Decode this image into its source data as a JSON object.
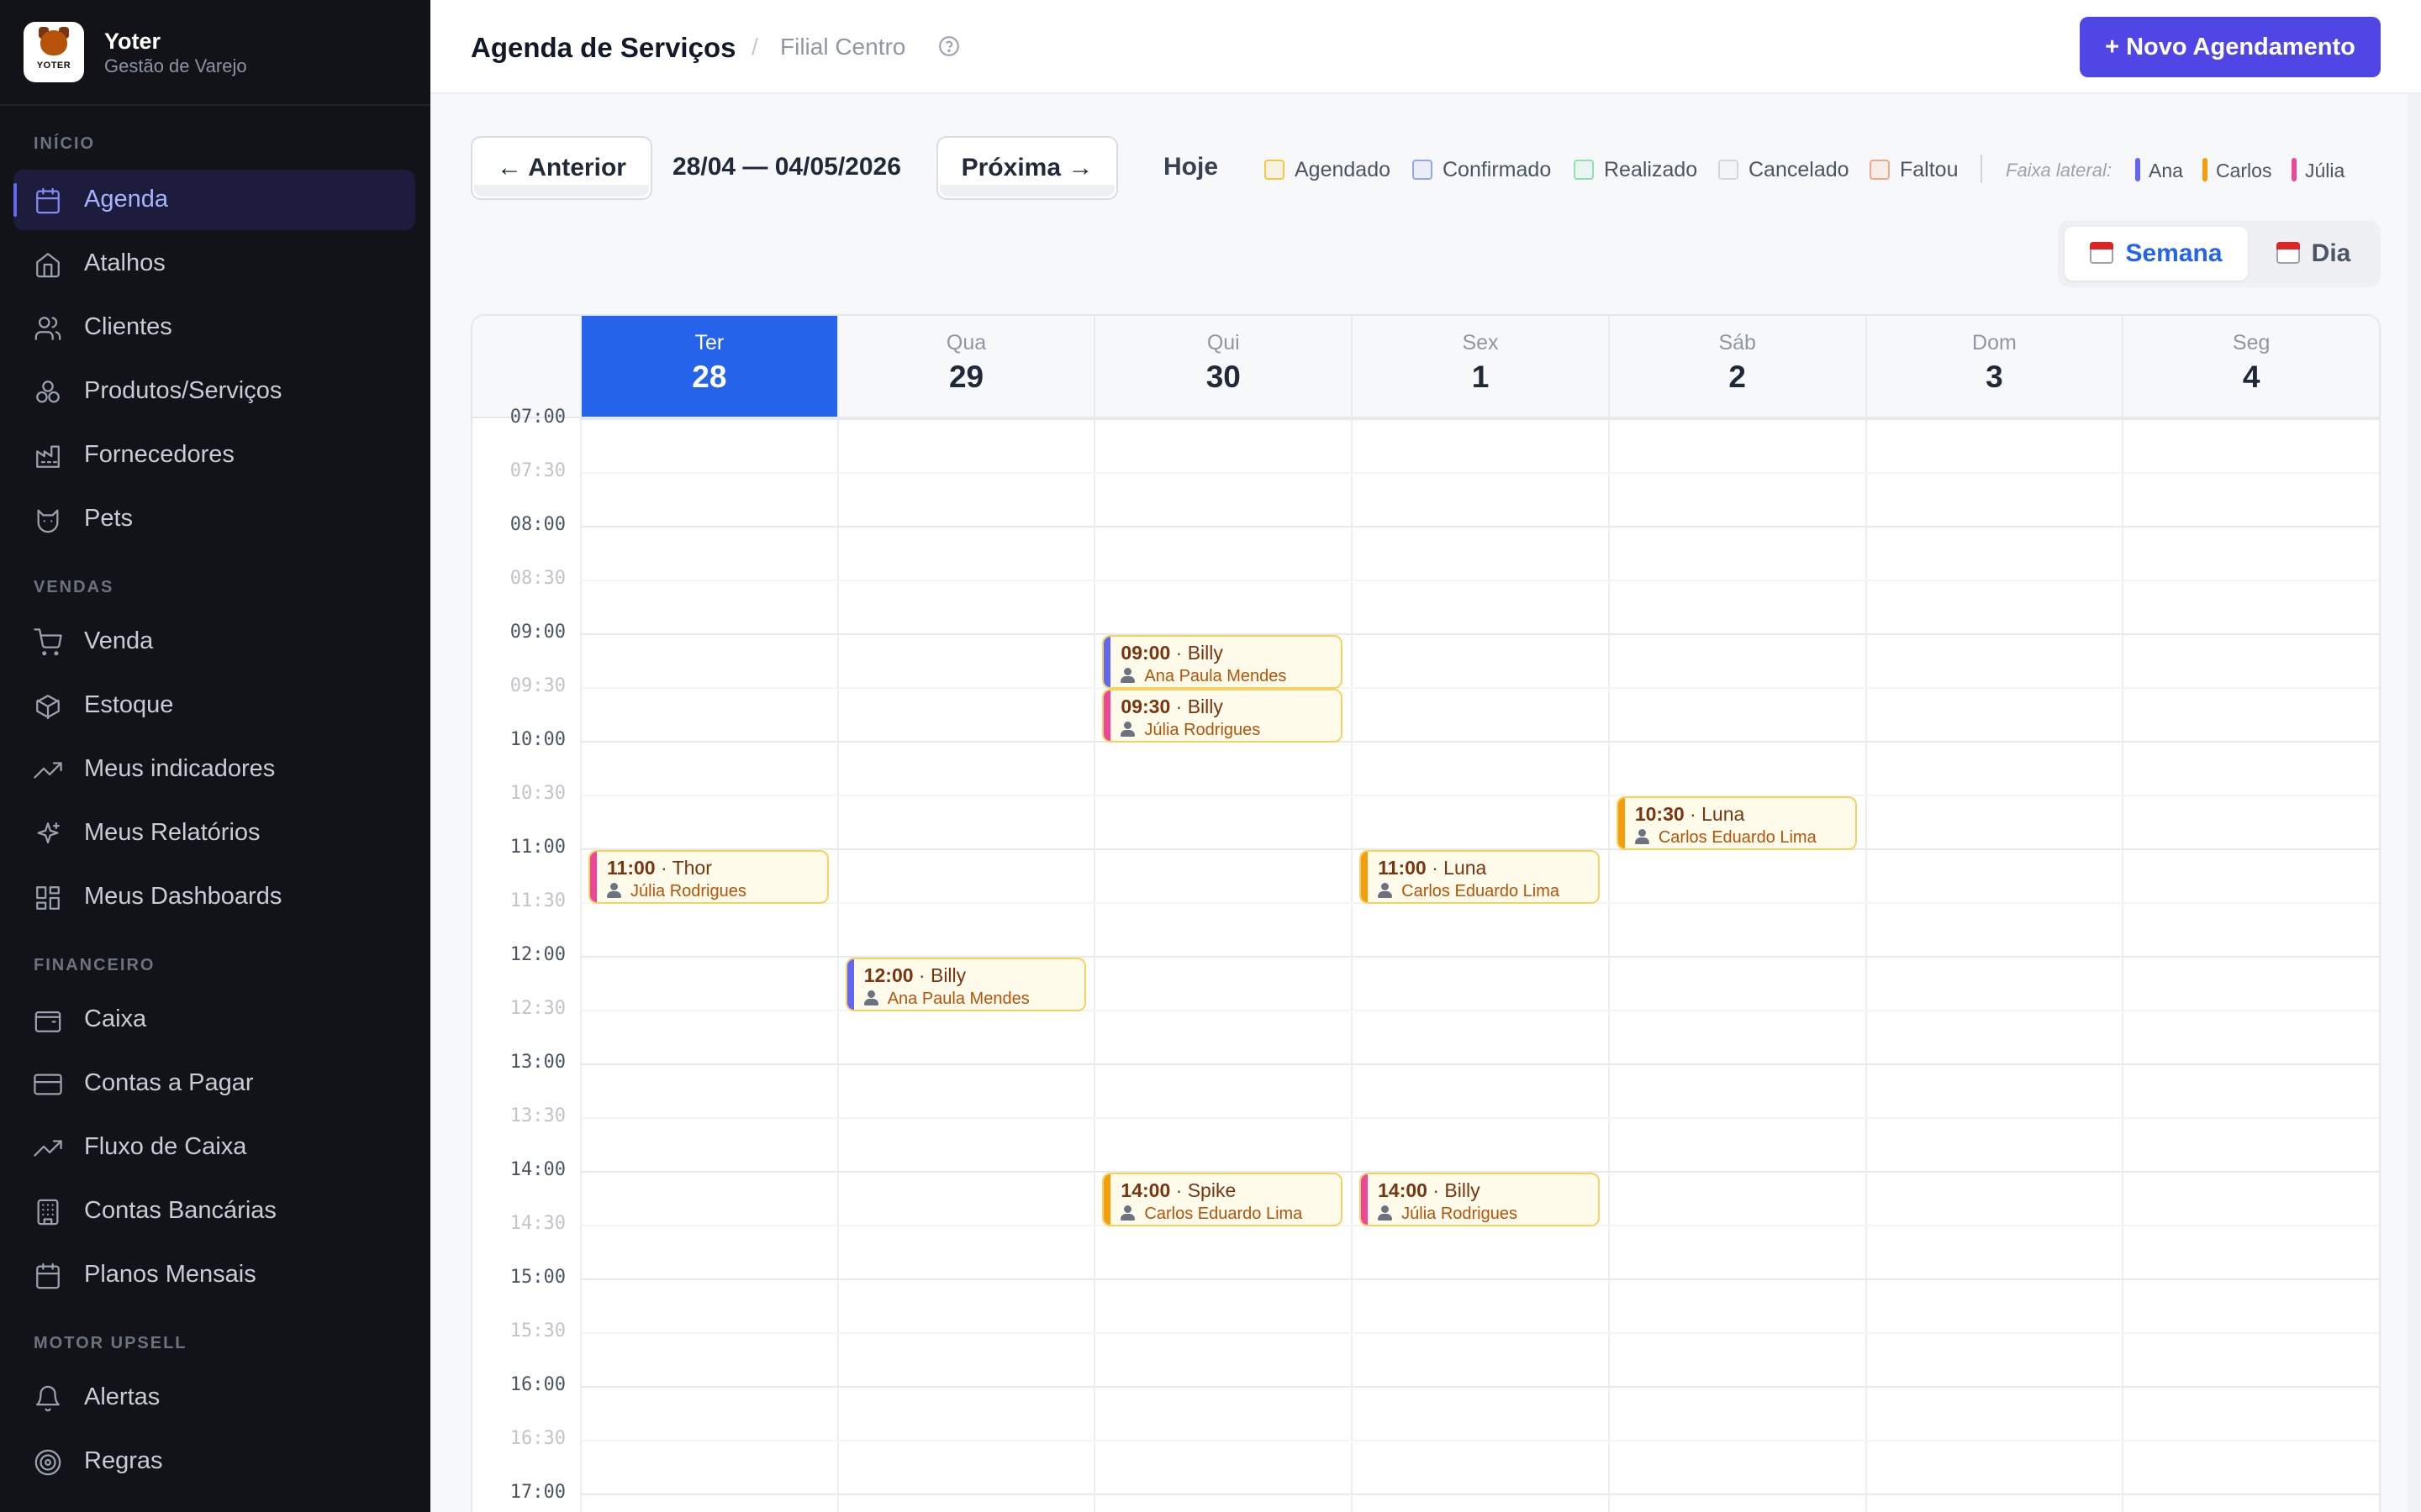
{
  "brand": {
    "name": "Yoter",
    "subtitle": "Gestão de Varejo",
    "logo_text": "YOTER",
    "logo_sub": "SISTEMA DE GESTÃO"
  },
  "sidebar": {
    "sections": [
      {
        "title": "INÍCIO",
        "items": [
          {
            "label": "Agenda",
            "icon": "calendar-icon",
            "active": true
          },
          {
            "label": "Atalhos",
            "icon": "home-icon"
          },
          {
            "label": "Clientes",
            "icon": "users-icon"
          },
          {
            "label": "Produtos/Serviços",
            "icon": "boxes-icon"
          },
          {
            "label": "Fornecedores",
            "icon": "factory-icon"
          },
          {
            "label": "Pets",
            "icon": "cat-icon"
          }
        ]
      },
      {
        "title": "VENDAS",
        "items": [
          {
            "label": "Venda",
            "icon": "cart-icon"
          },
          {
            "label": "Estoque",
            "icon": "package-icon"
          },
          {
            "label": "Meus indicadores",
            "icon": "trending-up-icon"
          },
          {
            "label": "Meus Relatórios",
            "icon": "sparkles-icon"
          },
          {
            "label": "Meus Dashboards",
            "icon": "dashboard-icon"
          }
        ]
      },
      {
        "title": "FINANCEIRO",
        "items": [
          {
            "label": "Caixa",
            "icon": "wallet-icon"
          },
          {
            "label": "Contas a Pagar",
            "icon": "credit-card-icon"
          },
          {
            "label": "Fluxo de Caixa",
            "icon": "trending-up-icon"
          },
          {
            "label": "Contas Bancárias",
            "icon": "building-icon"
          },
          {
            "label": "Planos Mensais",
            "icon": "calendar-icon"
          }
        ]
      },
      {
        "title": "MOTOR UPSELL",
        "items": [
          {
            "label": "Alertas",
            "icon": "bell-icon"
          },
          {
            "label": "Regras",
            "icon": "target-icon"
          }
        ]
      }
    ]
  },
  "header": {
    "title": "Agenda de Serviços",
    "separator": "/",
    "branch": "Filial Centro",
    "help_icon": "help-circle-icon",
    "new_button": "+ Novo Agendamento"
  },
  "toolbar": {
    "prev": "← Anterior",
    "range": "28/04 — 04/05/2026",
    "next": "Próxima →",
    "today": "Hoje",
    "legend": [
      {
        "label": "Agendado",
        "color": "#f5c842"
      },
      {
        "label": "Confirmado",
        "color": "#93a8e8"
      },
      {
        "label": "Realizado",
        "color": "#8ee0b4"
      },
      {
        "label": "Cancelado",
        "color": "#d4d6db"
      },
      {
        "label": "Faltou",
        "color": "#f0a58e"
      }
    ],
    "lane_label": "Faixa lateral:",
    "lanes": [
      {
        "label": "Ana",
        "color": "#6366f1"
      },
      {
        "label": "Carlos",
        "color": "#f59e0b"
      },
      {
        "label": "Júlia",
        "color": "#ec4899"
      }
    ],
    "views": {
      "week": "Semana",
      "day": "Dia",
      "active": "week"
    }
  },
  "calendar": {
    "days": [
      {
        "dow": "Ter",
        "num": "28",
        "today": true
      },
      {
        "dow": "Qua",
        "num": "29"
      },
      {
        "dow": "Qui",
        "num": "30"
      },
      {
        "dow": "Sex",
        "num": "1"
      },
      {
        "dow": "Sáb",
        "num": "2"
      },
      {
        "dow": "Dom",
        "num": "3"
      },
      {
        "dow": "Seg",
        "num": "4"
      }
    ],
    "times": [
      "07:00",
      "07:30",
      "08:00",
      "08:30",
      "09:00",
      "09:30",
      "10:00",
      "10:30",
      "11:00",
      "11:30",
      "12:00",
      "12:30",
      "13:00",
      "13:30",
      "14:00",
      "14:30",
      "15:00",
      "15:30",
      "16:00",
      "16:30",
      "17:00"
    ],
    "events": [
      {
        "day": 2,
        "time": "09:00",
        "pet": "Billy",
        "who": "Ana Paula Mendes",
        "lane": "#6366f1"
      },
      {
        "day": 2,
        "time": "09:30",
        "pet": "Billy",
        "who": "Júlia Rodrigues",
        "lane": "#ec4899"
      },
      {
        "day": 4,
        "time": "10:30",
        "pet": "Luna",
        "who": "Carlos Eduardo Lima",
        "lane": "#f59e0b"
      },
      {
        "day": 0,
        "time": "11:00",
        "pet": "Thor",
        "who": "Júlia Rodrigues",
        "lane": "#ec4899"
      },
      {
        "day": 3,
        "time": "11:00",
        "pet": "Luna",
        "who": "Carlos Eduardo Lima",
        "lane": "#f59e0b"
      },
      {
        "day": 1,
        "time": "12:00",
        "pet": "Billy",
        "who": "Ana Paula Mendes",
        "lane": "#6366f1"
      },
      {
        "day": 2,
        "time": "14:00",
        "pet": "Spike",
        "who": "Carlos Eduardo Lima",
        "lane": "#f59e0b"
      },
      {
        "day": 3,
        "time": "14:00",
        "pet": "Billy",
        "who": "Júlia Rodrigues",
        "lane": "#ec4899"
      }
    ]
  },
  "colors": {
    "accent": "#4f46e5",
    "today": "#2563eb",
    "sidebar_bg": "#111318"
  }
}
